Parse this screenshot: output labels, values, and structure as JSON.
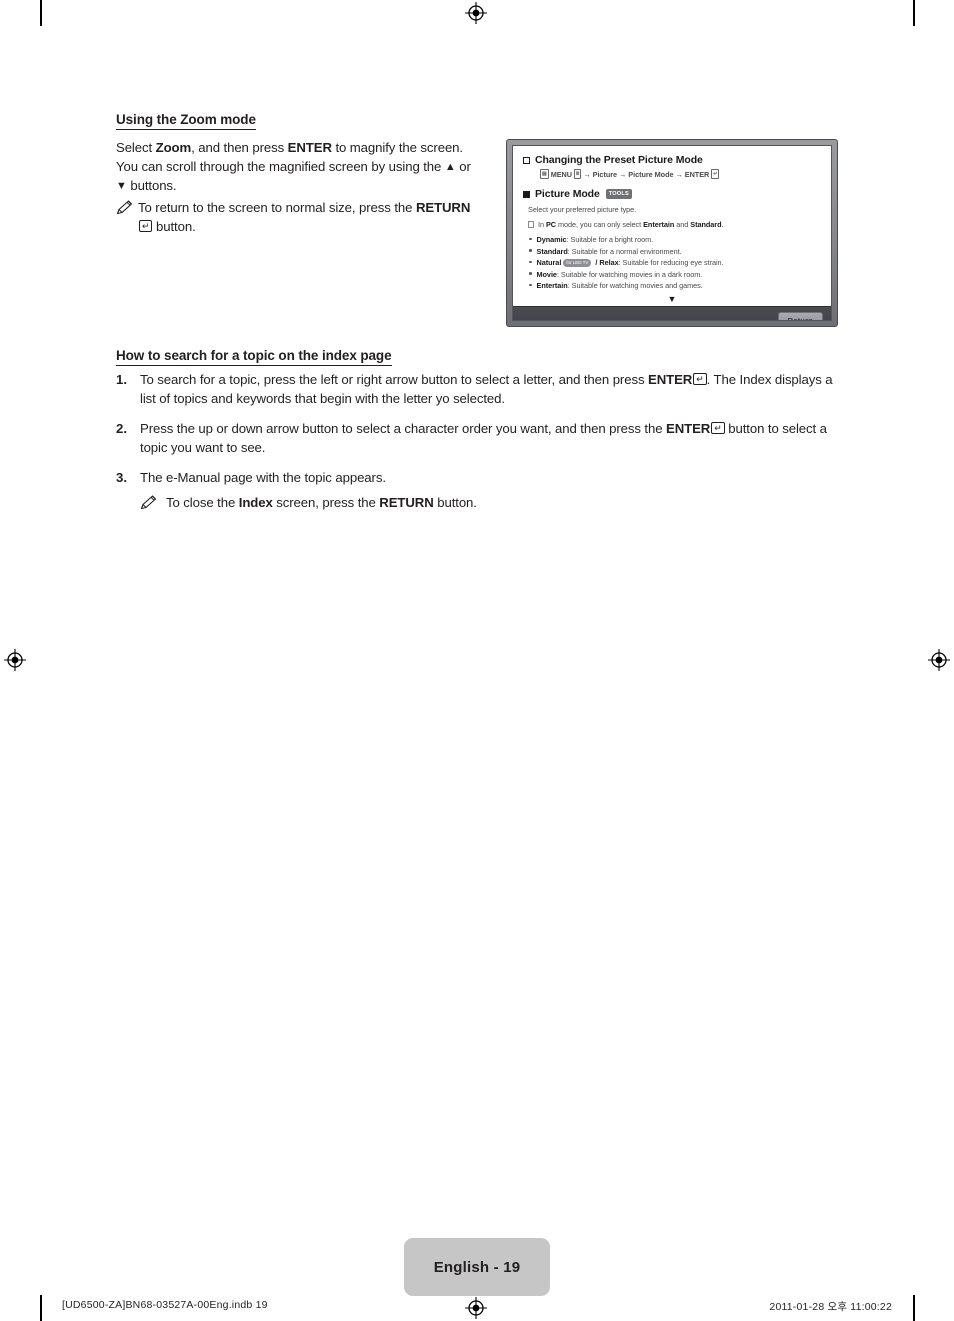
{
  "document": {
    "page_label": "English - 19",
    "footer_left": "[UD6500-ZA]BN68-03527A-00Eng.indb   19",
    "footer_right": "2011-01-28   오후 11:00:22"
  },
  "section_zoom": {
    "heading": "Using the Zoom mode",
    "paragraph_parts": {
      "p1": "Select ",
      "bold1": "Zoom",
      "p2": ", and then press ",
      "bold2": "ENTER",
      "p3": " to magnify the screen. You can scroll through the magnified screen by using the ",
      "arrow_up": "▲",
      "p4": " or ",
      "arrow_down": "▼",
      "p5": " buttons."
    },
    "note": {
      "prefix": "To return to the screen to normal size, press the ",
      "bold": "RETURN",
      "suffix": " button.",
      "icon": "pencil-note-icon"
    }
  },
  "section_index": {
    "heading": "How to search for a topic on the index page",
    "items": [
      {
        "number": "1.",
        "parts": {
          "a": "To search for a topic, press the left or right arrow button to select a letter, and then press ",
          "bold": "ENTER",
          "b": ". The Index displays a list of topics and keywords that begin with the letter yo selected."
        }
      },
      {
        "number": "2.",
        "parts": {
          "a": "Press the up or down arrow button to select a character order you want, and then press the ",
          "bold": "ENTER",
          "b": " button to select a topic you want to see."
        }
      },
      {
        "number": "3.",
        "parts": {
          "a": "The e-Manual page with the topic appears.",
          "bold": "",
          "b": ""
        }
      }
    ],
    "sub_note": {
      "prefix": "To close the ",
      "bold1": "Index",
      "mid": " screen, press the ",
      "bold2": "RETURN",
      "suffix": " button.",
      "icon": "pencil-note-icon"
    }
  },
  "tv_osd": {
    "title": "Changing the Preset Picture Mode",
    "menu_path": {
      "menu_label": "MENU",
      "arrow": "→",
      "step1": "Picture",
      "step2": "Picture Mode",
      "enter_label": "ENTER"
    },
    "item_title": "Picture Mode",
    "tools_badge": "TOOLS",
    "subtitle": "Select your preferred picture type.",
    "note": {
      "a": "In ",
      "bold1": "PC",
      "b": " mode, you can only select ",
      "bold2": "Entertain",
      "c": " and ",
      "bold3": "Standard",
      "d": "."
    },
    "bullets": [
      {
        "name": "Dynamic",
        "badge": "",
        "extra": "",
        "desc": ": Suitable for a bright room."
      },
      {
        "name": "Standard",
        "badge": "",
        "extra": "",
        "desc": ": Suitable for a normal environment."
      },
      {
        "name": "Natural",
        "badge": "for LED TV",
        "extra": " / Relax",
        "desc": ": Suitable for reducing eye strain."
      },
      {
        "name": "Movie",
        "badge": "",
        "extra": "",
        "desc": ": Suitable for watching movies in a dark room."
      },
      {
        "name": "Entertain",
        "badge": "",
        "extra": "",
        "desc": ": Suitable for watching movies and games."
      }
    ],
    "scroll_arrow": "▼",
    "return_button": "Return"
  },
  "colors": {
    "text": "#231f20",
    "page_badge_bg": "#c6c6c6",
    "tv_bezel": "#85868b",
    "osd_bar": "#3c3e44"
  }
}
